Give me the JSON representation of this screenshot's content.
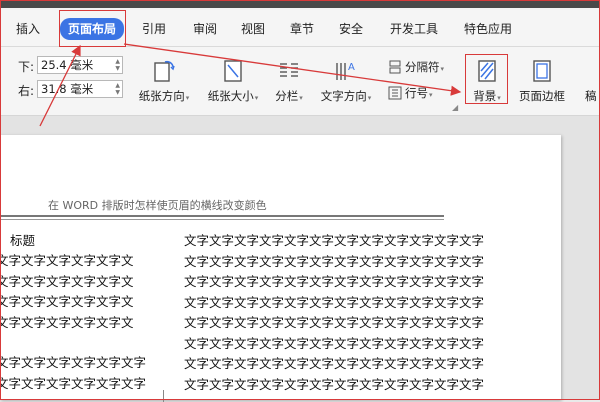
{
  "menu": {
    "tabs": [
      "插入",
      "页面布局",
      "引用",
      "审阅",
      "视图",
      "章节",
      "安全",
      "开发工具",
      "特色应用"
    ]
  },
  "ribbon": {
    "margins": {
      "bottom_label": "下:",
      "bottom_value": "25.4 毫米",
      "right_label": "右:",
      "right_value": "31.8 毫米"
    },
    "buttons": {
      "orientation": "纸张方向",
      "size": "纸张大小",
      "columns": "分栏",
      "text_direction": "文字方向",
      "breaks": "分隔符",
      "line_numbers": "行号",
      "background": "背景",
      "page_border": "页面边框",
      "partial": "稿"
    }
  },
  "document": {
    "header_text": "在 WORD 排版时怎样使页眉的横线改变颜色",
    "left_col": {
      "heading": "标题",
      "lines": [
        "文字文字文字文字文字文",
        "文字文字文字文字文字文",
        "文字文字文字文字文字文",
        "文字文字文字文字文字文"
      ],
      "lines_lower": [
        "文字文字文字文字文字文字",
        "文字文字文字文字文字文字"
      ]
    },
    "right_col": {
      "lines": [
        "文字文字文字文字文字文字文字文字文字文字文字文字",
        "文字文字文字文字文字文字文字文字文字文字文字文字",
        "文字文字文字文字文字文字文字文字文字文字文字文字",
        "文字文字文字文字文字文字文字文字文字文字文字文字",
        "文字文字文字文字文字文字文字文字文字文字文字文字",
        "文字文字文字文字文字文字文字文字文字文字文字文字",
        "文字文字文字文字文字文字文字文字文字文字文字文字",
        "文字文字文字文字文字文字文字文字文字文字文字文字"
      ]
    }
  },
  "colors": {
    "accent": "#3b74e4",
    "annotation": "#d83a3a"
  }
}
